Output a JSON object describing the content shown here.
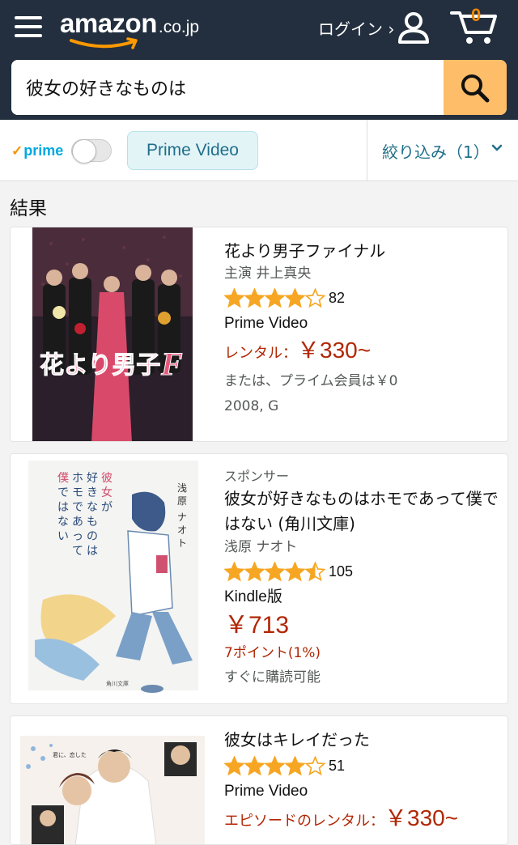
{
  "header": {
    "logo_text": "amazon",
    "logo_tld": ".co.jp",
    "login_label": "ログイン ›",
    "cart_count": "0"
  },
  "search": {
    "value": "彼女の好きなものは"
  },
  "filters": {
    "prime_label": "prime",
    "prime_toggle_on": false,
    "chip_label": "Prime Video",
    "refine_label": "絞り込み（1）"
  },
  "results_title": "結果",
  "results": [
    {
      "title": "花より男子ファイナル",
      "cast": "主演 井上真央",
      "rating": 4.0,
      "rating_count": "82",
      "format": "Prime Video",
      "rental_label": "レンタル：",
      "price": "￥330~",
      "extra": "または、プライム会員は￥0",
      "year_rating": "2008, G"
    },
    {
      "sponsor": "スポンサー",
      "title": "彼女が好きなものはホモであって僕ではない (角川文庫)",
      "author": "浅原 ナオト",
      "rating": 4.5,
      "rating_count": "105",
      "format": "Kindle版",
      "price": "￥713",
      "points": "7ポイント(1%)",
      "availability": "すぐに購読可能"
    },
    {
      "title": "彼女はキレイだった",
      "rating": 4.0,
      "rating_count": "51",
      "format": "Prime Video",
      "rental_label": "エピソードのレンタル：",
      "price": "￥330~"
    }
  ],
  "colors": {
    "header_bg": "#232f3e",
    "search_button": "#febd69",
    "price_red": "#b12704",
    "star_orange": "#f6a623",
    "prime_blue": "#00a8e1",
    "link_teal": "#1f6f8b"
  }
}
